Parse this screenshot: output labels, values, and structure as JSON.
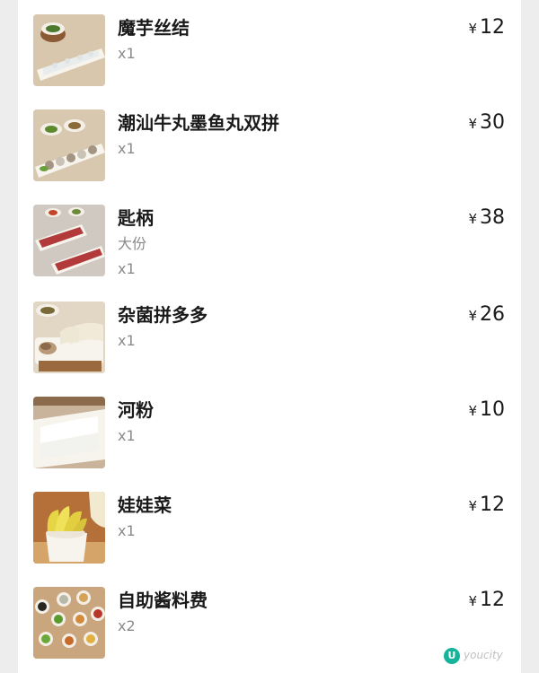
{
  "order_items": [
    {
      "name": "魔芋丝结",
      "spec": "",
      "quantity": "x1",
      "currency": "¥",
      "price": "12",
      "image_icon": "konjac-knot-plate-icon"
    },
    {
      "name": "潮汕牛丸墨鱼丸双拼",
      "spec": "",
      "quantity": "x1",
      "currency": "¥",
      "price": "30",
      "image_icon": "meatball-platter-icon"
    },
    {
      "name": "匙柄",
      "spec": "大份",
      "quantity": "x1",
      "currency": "¥",
      "price": "38",
      "image_icon": "sliced-beef-tray-icon"
    },
    {
      "name": "杂菌拼多多",
      "spec": "",
      "quantity": "x1",
      "currency": "¥",
      "price": "26",
      "image_icon": "mushroom-platter-icon"
    },
    {
      "name": "河粉",
      "spec": "",
      "quantity": "x1",
      "currency": "¥",
      "price": "10",
      "image_icon": "rice-noodle-tray-icon"
    },
    {
      "name": "娃娃菜",
      "spec": "",
      "quantity": "x1",
      "currency": "¥",
      "price": "12",
      "image_icon": "baby-cabbage-bowl-icon"
    },
    {
      "name": "自助酱料费",
      "spec": "",
      "quantity": "x2",
      "currency": "¥",
      "price": "12",
      "image_icon": "sauce-bowls-icon"
    }
  ],
  "watermark": {
    "logo_text": "U",
    "text": "youcity"
  },
  "colors": {
    "background": "#ededed",
    "card": "#ffffff",
    "text": "#1a1a1a",
    "muted": "#8a8a8a",
    "watermark_green": "#16b39b"
  }
}
